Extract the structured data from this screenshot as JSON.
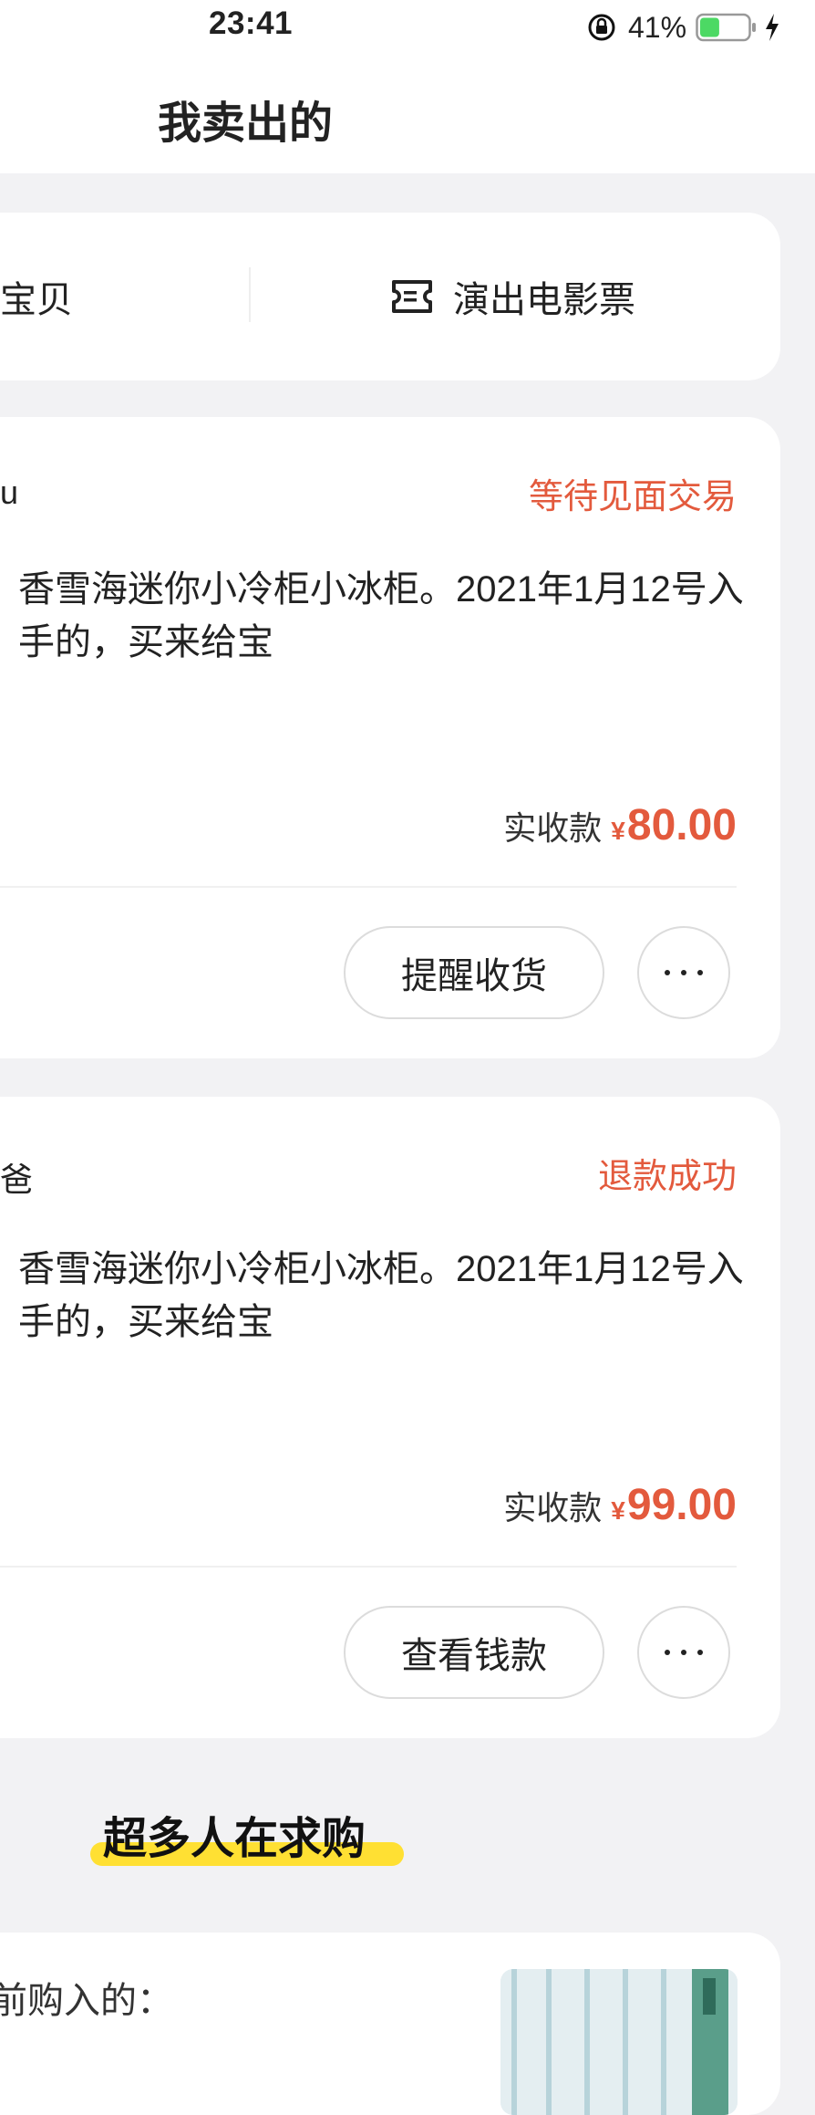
{
  "status_bar": {
    "time": "23:41",
    "battery_percent": "41%",
    "battery_level": 0.41
  },
  "header": {
    "title": "我卖出的"
  },
  "tabs": {
    "left_label": "钱宝贝",
    "right_label": "演出电影票"
  },
  "orders": [
    {
      "buyer": "u",
      "status": "等待见面交易",
      "description": "香雪海迷你小冷柜小冰柜。2021年1月12号入手的，买来给宝",
      "price_label": "实收款",
      "currency": "¥",
      "amount": "80.00",
      "action_label": "提醒收货"
    },
    {
      "buyer": "爸",
      "status": "退款成功",
      "description": "香雪海迷你小冷柜小冰柜。2021年1月12号入手的，买来给宝",
      "price_label": "实收款",
      "currency": "¥",
      "amount": "99.00",
      "action_label": "查看钱款"
    }
  ],
  "section": {
    "title": "超多人在求购"
  },
  "recommendation": {
    "text": "前购入的："
  },
  "colors": {
    "accent_red": "#e35a3d",
    "highlight_yellow": "#ffe033",
    "battery_green": "#4cd964"
  }
}
